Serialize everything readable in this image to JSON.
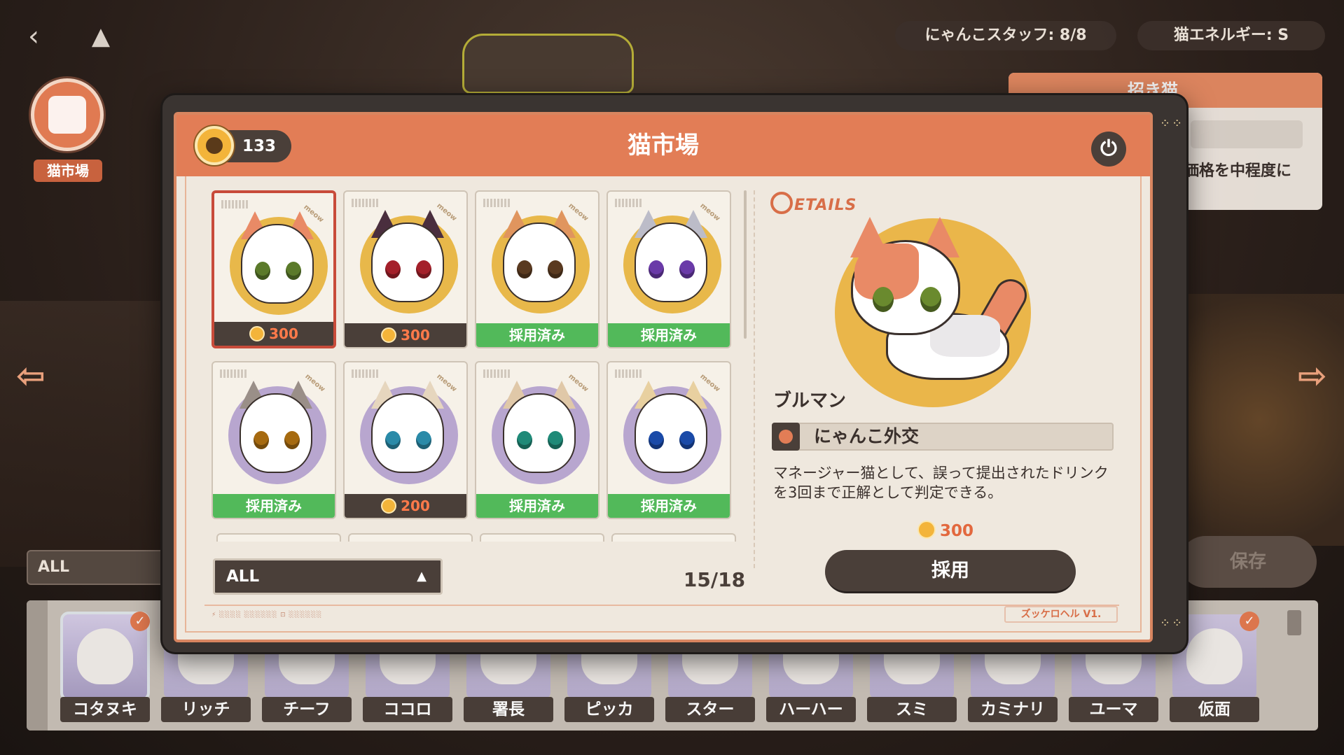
{
  "hud": {
    "staff": "にゃんこスタッフ: 8/8",
    "energy": "猫エネルギー:  S"
  },
  "left_badge": {
    "label": "猫市場"
  },
  "background_panel": {
    "title": "招き猫",
    "text": "価格を中程度に",
    "filter": "ALL",
    "save": "保存"
  },
  "market": {
    "title": "猫市場",
    "coins": "133",
    "filter_value": "ALL",
    "page": "15/18",
    "cards": [
      {
        "status": "price",
        "value": "300",
        "disc": "#e8b84a",
        "eye": "#5b7a2a",
        "ear": "#e98a66",
        "selected": true
      },
      {
        "status": "price",
        "value": "300",
        "disc": "#e8b84a",
        "eye": "#a4202a",
        "ear": "#4a2e3e",
        "selected": false
      },
      {
        "status": "adopted",
        "value": "採用済み",
        "disc": "#e8b84a",
        "eye": "#5a3a20",
        "ear": "#e0955e",
        "selected": false
      },
      {
        "status": "adopted",
        "value": "採用済み",
        "disc": "#e8b84a",
        "eye": "#6a3aa8",
        "ear": "#bcbcc8",
        "selected": false
      },
      {
        "status": "adopted",
        "value": "採用済み",
        "disc": "#b8a6cf",
        "eye": "#a66a10",
        "ear": "#9a8f88",
        "selected": false
      },
      {
        "status": "price",
        "value": "200",
        "disc": "#b8a6cf",
        "eye": "#2a8aa8",
        "ear": "#e6d6be",
        "selected": false
      },
      {
        "status": "adopted",
        "value": "採用済み",
        "disc": "#b8a6cf",
        "eye": "#1f8a78",
        "ear": "#e0c8a8",
        "selected": false
      },
      {
        "status": "adopted",
        "value": "採用済み",
        "disc": "#b8a6cf",
        "eye": "#1a4aa8",
        "ear": "#e8d0a0",
        "selected": false
      }
    ]
  },
  "details": {
    "logo": "ETAILS",
    "name": "ブルマン",
    "skill": "にゃんこ外交",
    "description": "マネージャー猫として、誤って提出されたドリンクを3回まで正解として判定できる。",
    "price": "300",
    "adopt": "採用"
  },
  "footer": {
    "version": "ズッケロヘル V1."
  },
  "roster": [
    {
      "name": "コタヌキ",
      "checked": true
    },
    {
      "name": "リッチ",
      "checked": false
    },
    {
      "name": "チーフ",
      "checked": false
    },
    {
      "name": "ココロ",
      "checked": false
    },
    {
      "name": "署長",
      "checked": false
    },
    {
      "name": "ピッカ",
      "checked": false
    },
    {
      "name": "スター",
      "checked": false
    },
    {
      "name": "ハーハー",
      "checked": false
    },
    {
      "name": "スミ",
      "checked": false
    },
    {
      "name": "カミナリ",
      "checked": false
    },
    {
      "name": "ユーマ",
      "checked": false
    },
    {
      "name": "仮面",
      "checked": true
    }
  ],
  "colors": {
    "accent": "#e27d56",
    "dark": "#4a3f39",
    "adopted": "#52b95a",
    "price": "#ff7a4a"
  }
}
